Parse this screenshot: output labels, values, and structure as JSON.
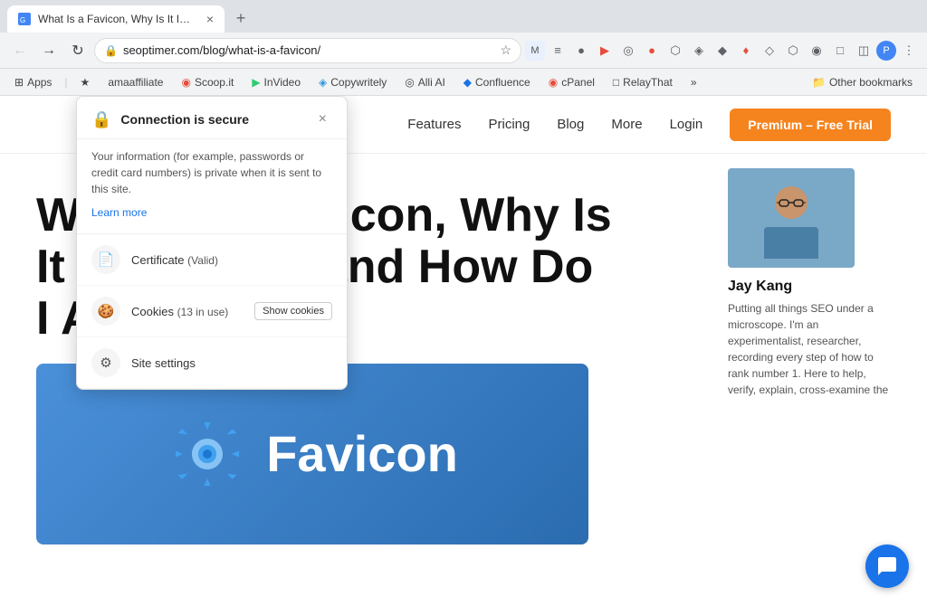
{
  "browser": {
    "tab": {
      "favicon_color": "#4285f4",
      "title": "What Is a Favicon, Why Is It Impo...",
      "close_label": "×"
    },
    "new_tab_label": "+",
    "nav": {
      "back_label": "←",
      "forward_label": "→",
      "reload_label": "↻",
      "home_label": "⊙"
    },
    "address": {
      "lock_label": "🔒",
      "url": "seoptimer.com/blog/what-is-a-favicon/",
      "star_label": "☆"
    },
    "toolbar_icons": [
      "⋮"
    ],
    "bookmarks": {
      "apps_label": "⊞",
      "apps_text": "Apps",
      "star_label": "★",
      "items": [
        {
          "label": "amaaffiliate"
        },
        {
          "label": "Scoop.it"
        },
        {
          "label": "InVideo"
        },
        {
          "label": "Copywritely"
        },
        {
          "label": "Alli AI"
        },
        {
          "label": "Confluence"
        },
        {
          "label": "cPanel"
        },
        {
          "label": "RelayThat"
        },
        {
          "label": "»"
        }
      ],
      "other_label": "Other bookmarks"
    }
  },
  "site": {
    "nav_items": [
      {
        "label": "Features"
      },
      {
        "label": "Pricing"
      },
      {
        "label": "Blog"
      },
      {
        "label": "More"
      },
      {
        "label": "Login"
      }
    ],
    "cta_label": "Premium – Free Trial"
  },
  "article": {
    "title": "What Is a Favicon, Why Is It Important, and How Do I Add One?",
    "featured_image_text": "Favicon"
  },
  "author": {
    "name": "Jay Kang",
    "bio": "Putting all things SEO under a microscope. I'm an experimentalist, researcher, recording every step of how to rank number 1. Here to help, verify, explain, cross-examine the"
  },
  "security_popup": {
    "title": "Connection is secure",
    "close_label": "×",
    "description": "Your information (for example, passwords or credit card numbers) is private when it is sent to this site.",
    "learn_more_label": "Learn more",
    "rows": [
      {
        "icon": "📄",
        "label": "Certificate",
        "badge": "(Valid)"
      },
      {
        "icon": "🍪",
        "label": "Cookies",
        "badge": "(13 in use)",
        "show_cookies_btn": "Show cookies"
      },
      {
        "icon": "⚙",
        "label": "Site settings"
      }
    ]
  },
  "chat": {
    "icon_label": "💬"
  }
}
